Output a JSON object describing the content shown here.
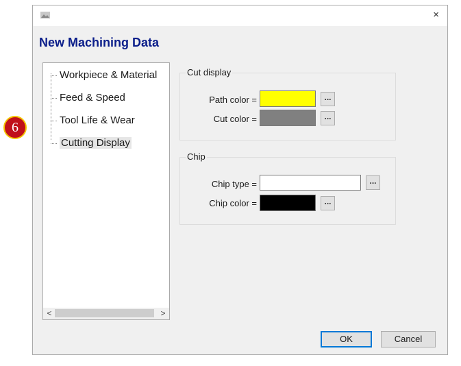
{
  "window": {
    "close_glyph": "×",
    "app_icon": "image-icon"
  },
  "dialog_title": "New Machining Data",
  "tree": {
    "items": [
      {
        "label": "Workpiece & Material",
        "selected": false
      },
      {
        "label": "Feed & Speed",
        "selected": false
      },
      {
        "label": "Tool Life & Wear",
        "selected": false
      },
      {
        "label": "Cutting Display",
        "selected": true
      }
    ],
    "scroll_left": "<",
    "scroll_right": ">"
  },
  "cut_display": {
    "title": "Cut display",
    "path_color_label": "Path color =",
    "path_color": "#ffff00",
    "cut_color_label": "Cut color =",
    "cut_color": "#808080",
    "browse_glyph": "..."
  },
  "chip": {
    "title": "Chip",
    "chip_type_label": "Chip type =",
    "chip_type_value": "",
    "chip_color_label": "Chip color =",
    "chip_color": "#000000",
    "browse_glyph": "..."
  },
  "buttons": {
    "ok": "OK",
    "cancel": "Cancel"
  },
  "callout": {
    "number": "6",
    "color": "#c0101a"
  }
}
